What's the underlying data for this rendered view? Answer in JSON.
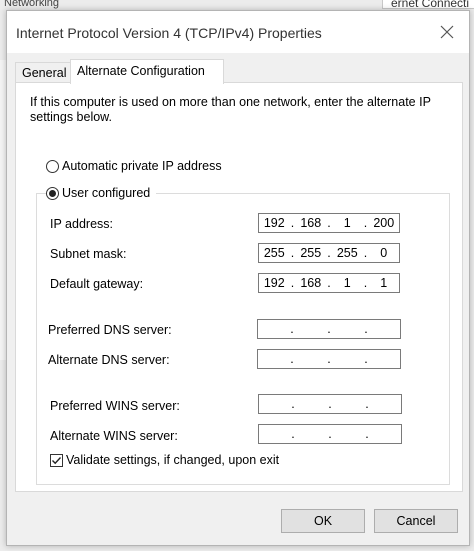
{
  "background": {
    "top_right_text": "ernet Connecti",
    "top_left_text": "Networking"
  },
  "dialog": {
    "title": "Internet Protocol Version 4 (TCP/IPv4) Properties",
    "tabs": [
      {
        "label": "General",
        "active": false
      },
      {
        "label": "Alternate Configuration",
        "active": true
      }
    ],
    "intro_text": "If this computer is used on more than one network, enter the alternate IP settings below.",
    "radio_auto": {
      "label": "Automatic private IP address",
      "selected": false
    },
    "radio_user": {
      "label": "User configured",
      "selected": true
    },
    "fields": {
      "ip_address": {
        "label": "IP address:",
        "octets": [
          "192",
          "168",
          "1",
          "200"
        ]
      },
      "subnet_mask": {
        "label": "Subnet mask:",
        "octets": [
          "255",
          "255",
          "255",
          "0"
        ]
      },
      "default_gateway": {
        "label": "Default gateway:",
        "octets": [
          "192",
          "168",
          "1",
          "1"
        ]
      },
      "preferred_dns": {
        "label": "Preferred DNS server:",
        "octets": [
          "",
          "",
          "",
          ""
        ]
      },
      "alternate_dns": {
        "label": "Alternate DNS server:",
        "octets": [
          "",
          "",
          "",
          ""
        ]
      },
      "preferred_wins": {
        "label": "Preferred WINS server:",
        "octets": [
          "",
          "",
          "",
          ""
        ]
      },
      "alternate_wins": {
        "label": "Alternate WINS server:",
        "octets": [
          "",
          "",
          "",
          ""
        ]
      }
    },
    "validate_checkbox": {
      "label": "Validate settings, if changed, upon exit",
      "checked": true
    },
    "buttons": {
      "ok": "OK",
      "cancel": "Cancel"
    },
    "dot_char": "."
  }
}
